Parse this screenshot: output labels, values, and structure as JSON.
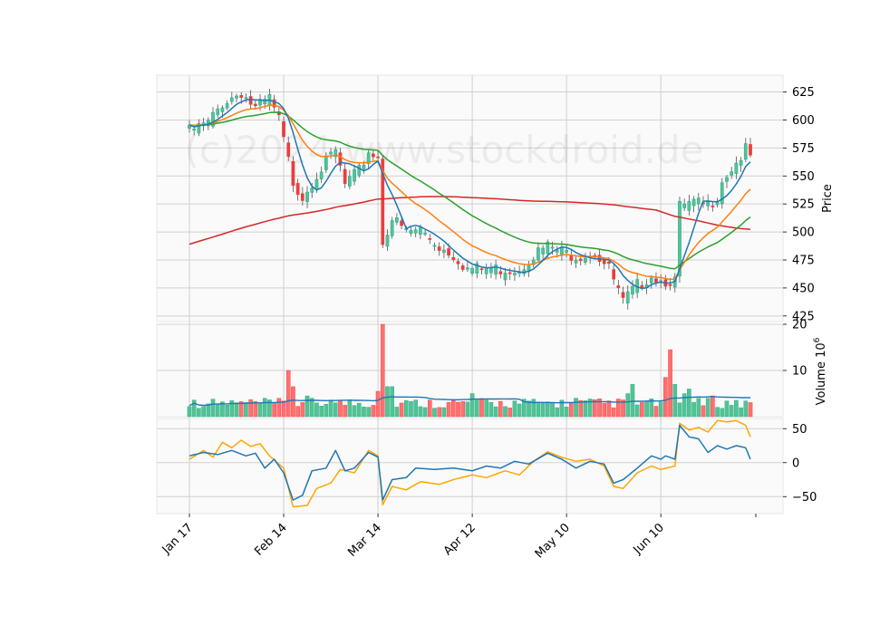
{
  "watermark": "(c)2024 www.stockdroid.de",
  "colors": {
    "panel_bg": "#fafafa",
    "grid": "#d0d0d0",
    "up": "#26a69a",
    "up_fill": "#52c48f",
    "down": "#ef3b3b",
    "down_fill": "#ff7070",
    "ma_fast": "#1f77b4",
    "ma_mid": "#ff7f0e",
    "ma_slow": "#2ca02c",
    "ma_long": "#d62728",
    "vol_ma": "#1f77b4",
    "osc_a": "#1f77b4",
    "osc_b": "#ffa500"
  },
  "chart_data": [
    {
      "type": "candlestick",
      "panel": "price",
      "ylabel": "Price",
      "ylim": [
        420,
        640
      ],
      "yticks": [
        "425",
        "450",
        "475",
        "500",
        "525",
        "550",
        "575",
        "600",
        "625"
      ],
      "xticks": [
        "Jan 17",
        "Feb 14",
        "Mar 14",
        "Apr 12",
        "May 10",
        "Jun 10"
      ],
      "xtick_index": [
        0,
        20,
        40,
        60,
        80,
        100
      ],
      "n_sessions": 120,
      "anchors": [
        {
          "i": 0,
          "c": 593
        },
        {
          "i": 4,
          "c": 600
        },
        {
          "i": 7,
          "c": 618
        },
        {
          "i": 11,
          "c": 628
        },
        {
          "i": 14,
          "c": 613
        },
        {
          "i": 17,
          "c": 622
        },
        {
          "i": 19,
          "c": 603
        },
        {
          "i": 22,
          "c": 548
        },
        {
          "i": 24,
          "c": 535
        },
        {
          "i": 27,
          "c": 555
        },
        {
          "i": 31,
          "c": 575
        },
        {
          "i": 33,
          "c": 545
        },
        {
          "i": 36,
          "c": 557
        },
        {
          "i": 38,
          "c": 575
        },
        {
          "i": 40,
          "c": 570
        },
        {
          "i": 41,
          "c": 495
        },
        {
          "i": 43,
          "c": 515
        },
        {
          "i": 46,
          "c": 503
        },
        {
          "i": 49,
          "c": 505
        },
        {
          "i": 53,
          "c": 490
        },
        {
          "i": 56,
          "c": 483
        },
        {
          "i": 59,
          "c": 470
        },
        {
          "i": 63,
          "c": 470
        },
        {
          "i": 66,
          "c": 470
        },
        {
          "i": 70,
          "c": 470
        },
        {
          "i": 73,
          "c": 483
        },
        {
          "i": 76,
          "c": 490
        },
        {
          "i": 79,
          "c": 485
        },
        {
          "i": 82,
          "c": 482
        },
        {
          "i": 86,
          "c": 485
        },
        {
          "i": 89,
          "c": 470
        },
        {
          "i": 92,
          "c": 440
        },
        {
          "i": 95,
          "c": 455
        },
        {
          "i": 98,
          "c": 465
        },
        {
          "i": 100,
          "c": 460
        },
        {
          "i": 103,
          "c": 460
        },
        {
          "i": 104,
          "c": 525
        },
        {
          "i": 107,
          "c": 528
        },
        {
          "i": 110,
          "c": 527
        },
        {
          "i": 112,
          "c": 535
        },
        {
          "i": 113,
          "c": 550
        },
        {
          "i": 116,
          "c": 565
        },
        {
          "i": 118,
          "c": 576
        },
        {
          "i": 119,
          "c": 570
        }
      ]
    },
    {
      "type": "bar",
      "panel": "volume",
      "ylabel": "Volume  10",
      "ylabel_exp": "6",
      "ylim": [
        0,
        20
      ],
      "yticks": [
        "10",
        "20"
      ],
      "spikes": [
        {
          "i": 21,
          "v": 10
        },
        {
          "i": 22,
          "v": 6.5
        },
        {
          "i": 41,
          "v": 20
        },
        {
          "i": 40,
          "v": 5.5
        },
        {
          "i": 42,
          "v": 6.5
        },
        {
          "i": 43,
          "v": 6.5
        },
        {
          "i": 101,
          "v": 8.5
        },
        {
          "i": 102,
          "v": 14.5
        },
        {
          "i": 103,
          "v": 7
        },
        {
          "i": 105,
          "v": 5
        },
        {
          "i": 106,
          "v": 6
        },
        {
          "i": 94,
          "v": 7
        },
        {
          "i": 93,
          "v": 5
        },
        {
          "i": 60,
          "v": 5
        },
        {
          "i": 82,
          "v": 4
        },
        {
          "i": 110,
          "v": 4
        },
        {
          "i": 111,
          "v": 4.5
        },
        {
          "i": 5,
          "v": 3.8
        },
        {
          "i": 25,
          "v": 4.5
        },
        {
          "i": 26,
          "v": 4
        },
        {
          "i": 30,
          "v": 3.5
        }
      ]
    },
    {
      "type": "line",
      "panel": "oscillator",
      "ylim": [
        -75,
        65
      ],
      "yticks": [
        "−50",
        "0",
        "50"
      ],
      "series": [
        {
          "anchors": [
            {
              "i": 0,
              "v": 10
            },
            {
              "i": 3,
              "v": 15
            },
            {
              "i": 6,
              "v": 12
            },
            {
              "i": 9,
              "v": 18
            },
            {
              "i": 12,
              "v": 10
            },
            {
              "i": 14,
              "v": 14
            },
            {
              "i": 16,
              "v": -8
            },
            {
              "i": 18,
              "v": 5
            },
            {
              "i": 20,
              "v": -15
            },
            {
              "i": 22,
              "v": -55
            },
            {
              "i": 24,
              "v": -48
            },
            {
              "i": 26,
              "v": -12
            },
            {
              "i": 29,
              "v": -8
            },
            {
              "i": 31,
              "v": 18
            },
            {
              "i": 33,
              "v": -12
            },
            {
              "i": 35,
              "v": -8
            },
            {
              "i": 38,
              "v": 15
            },
            {
              "i": 40,
              "v": 8
            },
            {
              "i": 41,
              "v": -55
            },
            {
              "i": 43,
              "v": -25
            },
            {
              "i": 46,
              "v": -22
            },
            {
              "i": 48,
              "v": -8
            },
            {
              "i": 52,
              "v": -10
            },
            {
              "i": 56,
              "v": -8
            },
            {
              "i": 60,
              "v": -12
            },
            {
              "i": 63,
              "v": -5
            },
            {
              "i": 66,
              "v": -8
            },
            {
              "i": 69,
              "v": 2
            },
            {
              "i": 72,
              "v": -2
            },
            {
              "i": 76,
              "v": 14
            },
            {
              "i": 79,
              "v": 5
            },
            {
              "i": 82,
              "v": -8
            },
            {
              "i": 85,
              "v": 2
            },
            {
              "i": 88,
              "v": -2
            },
            {
              "i": 90,
              "v": -30
            },
            {
              "i": 92,
              "v": -25
            },
            {
              "i": 95,
              "v": -8
            },
            {
              "i": 98,
              "v": 10
            },
            {
              "i": 100,
              "v": 5
            },
            {
              "i": 101,
              "v": 10
            },
            {
              "i": 103,
              "v": 5
            },
            {
              "i": 104,
              "v": 55
            },
            {
              "i": 106,
              "v": 38
            },
            {
              "i": 108,
              "v": 35
            },
            {
              "i": 110,
              "v": 15
            },
            {
              "i": 112,
              "v": 25
            },
            {
              "i": 114,
              "v": 20
            },
            {
              "i": 116,
              "v": 25
            },
            {
              "i": 118,
              "v": 22
            },
            {
              "i": 119,
              "v": 5
            }
          ]
        },
        {
          "anchors": [
            {
              "i": 0,
              "v": 5
            },
            {
              "i": 3,
              "v": 18
            },
            {
              "i": 5,
              "v": 8
            },
            {
              "i": 7,
              "v": 30
            },
            {
              "i": 9,
              "v": 22
            },
            {
              "i": 11,
              "v": 33
            },
            {
              "i": 13,
              "v": 24
            },
            {
              "i": 15,
              "v": 28
            },
            {
              "i": 17,
              "v": 10
            },
            {
              "i": 20,
              "v": -8
            },
            {
              "i": 22,
              "v": -65
            },
            {
              "i": 25,
              "v": -63
            },
            {
              "i": 27,
              "v": -38
            },
            {
              "i": 30,
              "v": -30
            },
            {
              "i": 32,
              "v": -10
            },
            {
              "i": 35,
              "v": -15
            },
            {
              "i": 38,
              "v": 18
            },
            {
              "i": 40,
              "v": 10
            },
            {
              "i": 41,
              "v": -62
            },
            {
              "i": 43,
              "v": -35
            },
            {
              "i": 46,
              "v": -40
            },
            {
              "i": 49,
              "v": -28
            },
            {
              "i": 53,
              "v": -32
            },
            {
              "i": 56,
              "v": -25
            },
            {
              "i": 60,
              "v": -18
            },
            {
              "i": 63,
              "v": -22
            },
            {
              "i": 67,
              "v": -12
            },
            {
              "i": 70,
              "v": -18
            },
            {
              "i": 73,
              "v": 2
            },
            {
              "i": 76,
              "v": 16
            },
            {
              "i": 79,
              "v": 8
            },
            {
              "i": 82,
              "v": 2
            },
            {
              "i": 85,
              "v": 5
            },
            {
              "i": 88,
              "v": -5
            },
            {
              "i": 90,
              "v": -35
            },
            {
              "i": 92,
              "v": -38
            },
            {
              "i": 95,
              "v": -15
            },
            {
              "i": 98,
              "v": -5
            },
            {
              "i": 100,
              "v": -10
            },
            {
              "i": 103,
              "v": -5
            },
            {
              "i": 104,
              "v": 58
            },
            {
              "i": 106,
              "v": 48
            },
            {
              "i": 108,
              "v": 52
            },
            {
              "i": 110,
              "v": 45
            },
            {
              "i": 112,
              "v": 62
            },
            {
              "i": 114,
              "v": 60
            },
            {
              "i": 116,
              "v": 62
            },
            {
              "i": 118,
              "v": 55
            },
            {
              "i": 119,
              "v": 38
            }
          ]
        }
      ]
    }
  ]
}
